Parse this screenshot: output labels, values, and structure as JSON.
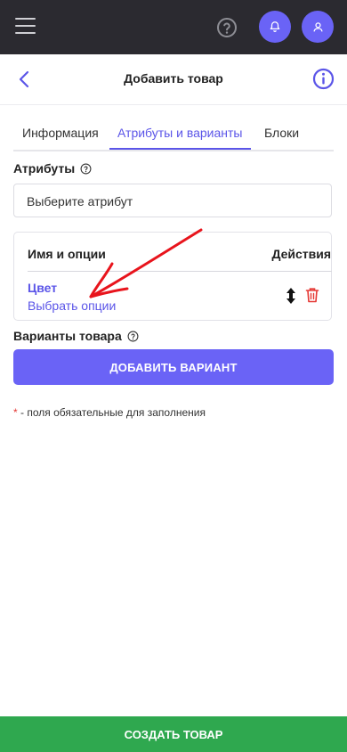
{
  "topbar": {
    "menu_icon": "hamburger-icon",
    "help_icon": "question-circle-icon",
    "bell_icon": "bell-icon",
    "user_icon": "user-icon"
  },
  "header": {
    "title": "Добавить товар",
    "back_icon": "chevron-left-icon",
    "info_icon": "info-icon"
  },
  "tabs": [
    {
      "label": "Информация",
      "active": false
    },
    {
      "label": "Атрибуты и варианты",
      "active": true
    },
    {
      "label": "Блоки",
      "active": false
    }
  ],
  "attributes": {
    "label": "Атрибуты",
    "select_placeholder": "Выберите атрибут"
  },
  "table": {
    "col_name": "Имя и опции",
    "col_actions": "Действия",
    "rows": [
      {
        "name": "Цвет",
        "options_link": "Выбрать опции"
      }
    ]
  },
  "variants": {
    "label": "Варианты товара",
    "add_button": "ДОБАВИТЬ ВАРИАНТ"
  },
  "required_note": {
    "star": "*",
    "text": " - поля обязательные для заполнения"
  },
  "footer": {
    "create_button": "СОЗДАТЬ ТОВАР"
  },
  "colors": {
    "accent": "#6a63f6",
    "topbar": "#2b2a30",
    "success": "#2fa84f",
    "danger": "#e53935",
    "annotation": "#e8141c"
  }
}
